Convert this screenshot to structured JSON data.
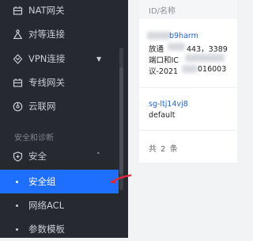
{
  "sidebar": {
    "items": [
      {
        "label": "NAT网关",
        "icon": "nat-gateway-icon"
      },
      {
        "label": "对等连接",
        "icon": "peering-icon"
      },
      {
        "label": "VPN连接",
        "icon": "vpn-icon",
        "expandable": true
      },
      {
        "label": "专线网关",
        "icon": "direct-connect-gateway-icon"
      },
      {
        "label": "云联网",
        "icon": "ccn-icon"
      }
    ],
    "section_title": "安全和诊断",
    "security": {
      "label": "安全",
      "icon": "shield-icon",
      "expanded": true
    },
    "sub_items": [
      {
        "label": "安全组",
        "active": true
      },
      {
        "label": "网络ACL",
        "active": false
      },
      {
        "label": "参数模板",
        "active": false
      }
    ]
  },
  "table": {
    "column_header": "ID/名称",
    "rows": [
      {
        "id": "b9harm",
        "lines": [
          "放通",
          "443，3389",
          "端口和IC",
          "议-2021",
          "016003"
        ]
      },
      {
        "id": "sg-ltj14vj8",
        "name": "default"
      }
    ],
    "footer": "共 2 条"
  },
  "colors": {
    "sidebar_bg": "#26292f",
    "active_bg": "#1f6fff",
    "link": "#2266cc",
    "annotation_arrow": "#e5283b"
  }
}
